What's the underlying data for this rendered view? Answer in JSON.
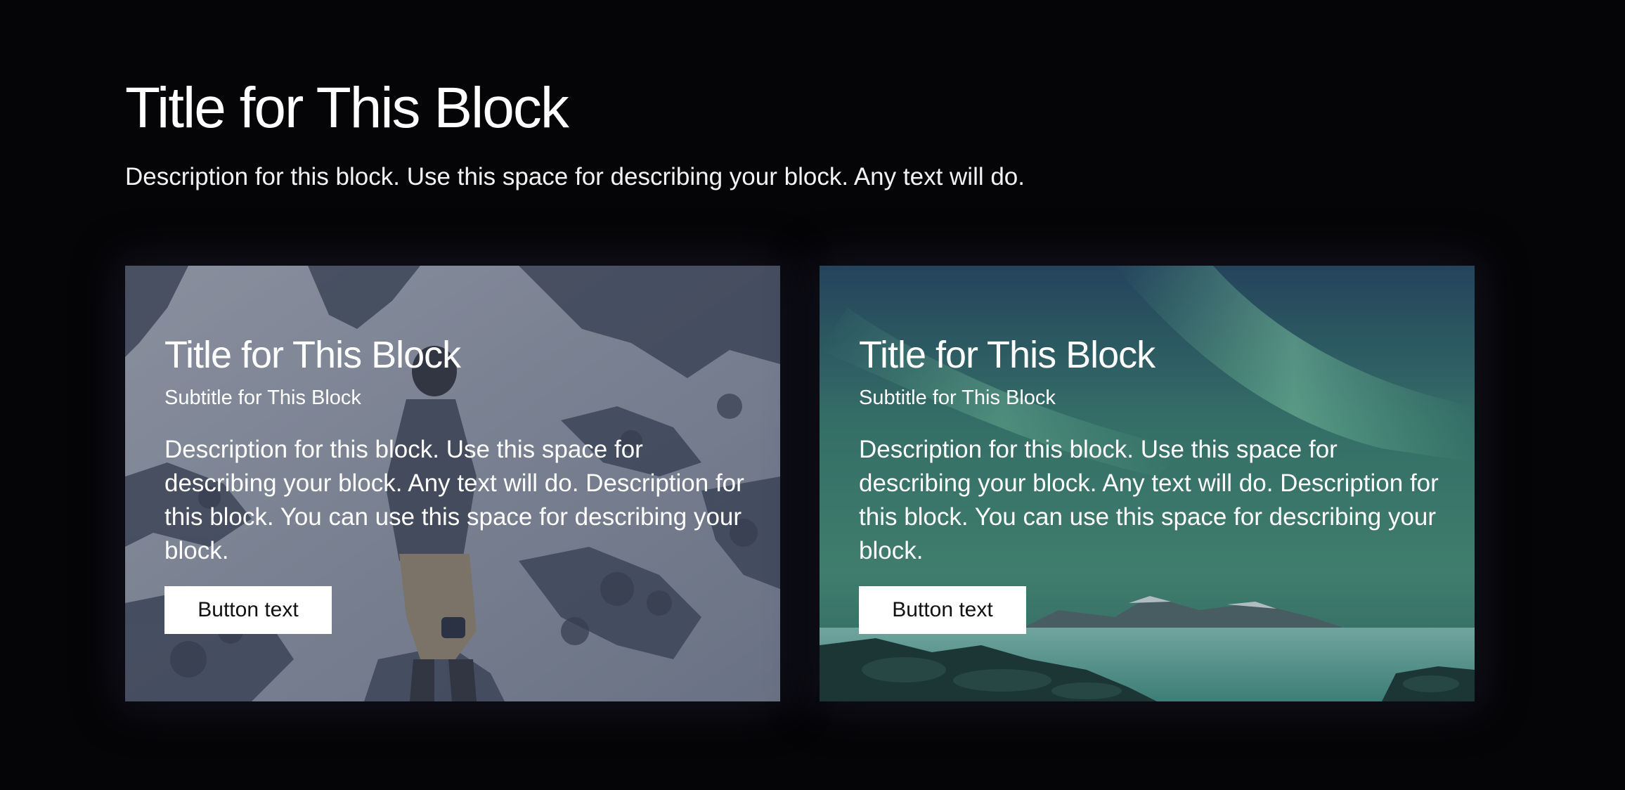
{
  "header": {
    "title": "Title for This Block",
    "description": "Description for this block. Use this space for describing your block. Any text will do."
  },
  "cards": [
    {
      "image": "snowy-mountain-hiker-photo",
      "title": "Title for This Block",
      "subtitle": "Subtitle for This Block",
      "description": "Description for this block. Use this space for describing your block. Any text will do. Description for this block. You can use this space for describing your block.",
      "button_label": "Button text"
    },
    {
      "image": "aurora-coastline-photo",
      "title": "Title for This Block",
      "subtitle": "Subtitle for This Block",
      "description": "Description for this block. Use this space for describing your block. Any text will do. Description for this block. You can use this space for describing your block.",
      "button_label": "Button text"
    }
  ],
  "colors": {
    "page_background": "#050507",
    "text": "#ffffff",
    "button_background": "#ffffff",
    "button_text": "#111111"
  }
}
